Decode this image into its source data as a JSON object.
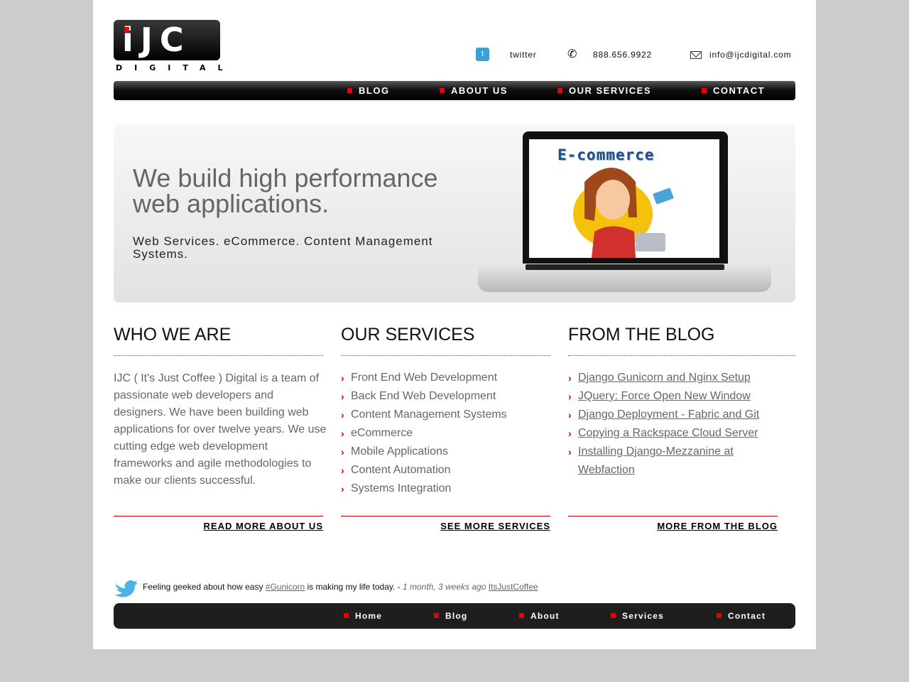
{
  "logo": {
    "letters": "iJC",
    "sub": "DIGITAL"
  },
  "contacts": {
    "twitter": "twitter",
    "phone": "888.656.9922",
    "email": "info@ijcdigital.com"
  },
  "topnav": [
    "BLOG",
    "ABOUT US",
    "OUR SERVICES",
    "CONTACT"
  ],
  "hero": {
    "title": "We build high performance web applications.",
    "subtitle": "Web Services. eCommerce. Content Management Systems.",
    "screen_text": "E-commerce"
  },
  "who": {
    "title": "WHO WE ARE",
    "text": "IJC ( It's Just Coffee ) Digital is a team of passionate web developers and designers. We have been building web applications for over twelve years.  We use cutting edge web development frameworks and agile methodologies to make our clients successful.",
    "more": "READ MORE ABOUT US"
  },
  "services": {
    "title": "OUR SERVICES",
    "items": [
      "Front End Web Development",
      "Back End Web Development",
      "Content Management Systems",
      "eCommerce",
      "Mobile Applications",
      "Content Automation",
      "Systems Integration"
    ],
    "more": "SEE MORE SERVICES"
  },
  "blog": {
    "title": "FROM THE BLOG",
    "items": [
      "Django Gunicorn and Nginx Setup",
      "JQuery: Force Open New Window",
      "Django Deployment - Fabric and Git",
      "Copying a Rackspace Cloud Server",
      "Installing Django-Mezzanine at Webfaction"
    ],
    "more": "MORE FROM THE BLOG"
  },
  "tweet": {
    "pre": "Feeling geeked about how easy ",
    "tag": "#Gunicorn",
    "post": " is making my life today. - ",
    "time": "1 month, 3 weeks ago",
    "user": "ItsJustCoffee"
  },
  "footnav": [
    "Home",
    "Blog",
    "About",
    "Services",
    "Contact"
  ],
  "colors": {
    "accent": "#dd0000",
    "nav_bg": "#1e1e1e",
    "text_gray": "#666666"
  }
}
